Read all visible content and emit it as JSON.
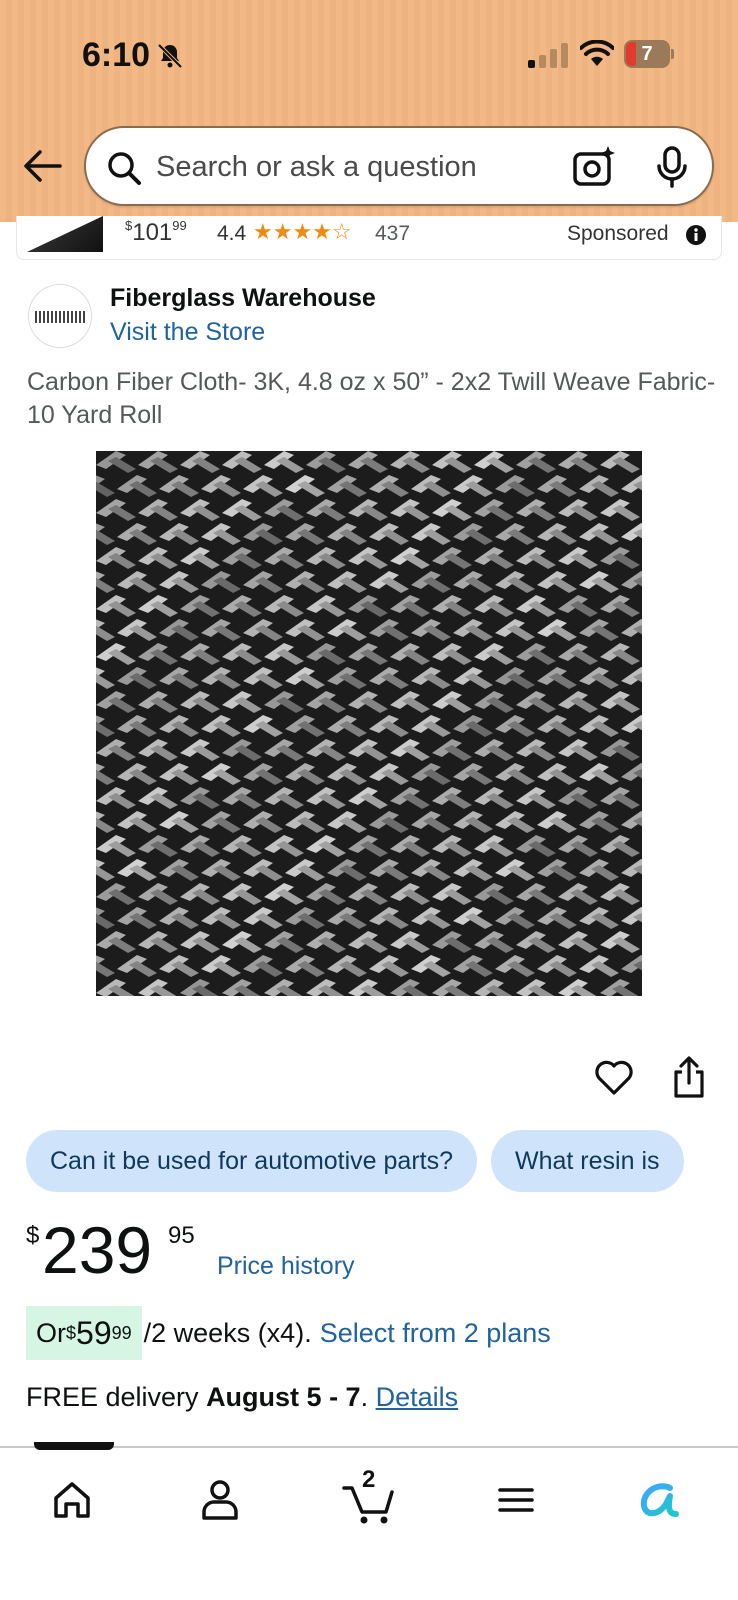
{
  "status_bar": {
    "time": "6:10",
    "battery": "7"
  },
  "search": {
    "placeholder": "Search or ask a question"
  },
  "sponsored_strip": {
    "price_symbol": "$",
    "price_whole": "101",
    "price_fraction": "99",
    "rating": "4.4",
    "stars": "★★★★☆",
    "review_count": "437",
    "label": "Sponsored"
  },
  "brand": {
    "name": "Fiberglass Warehouse",
    "store_link": "Visit the Store"
  },
  "product": {
    "title": "Carbon Fiber Cloth- 3K, 4.8 oz x 50” - 2x2 Twill Weave Fabric- 10 Yard Roll"
  },
  "questions": [
    "Can it be used for automotive parts?",
    "What resin is"
  ],
  "price": {
    "symbol": "$",
    "whole": "239",
    "fraction": "95",
    "history_link": "Price history"
  },
  "installment": {
    "prefix": "Or ",
    "symbol": "$",
    "whole": "59",
    "fraction": "99",
    "terms": " /2 weeks (x4).",
    "link": "Select from 2 plans"
  },
  "delivery": {
    "prefix": "FREE delivery ",
    "dates": "August 5 - 7",
    "separator": ". ",
    "link": "Details"
  },
  "tabbar": {
    "cart_count": "2"
  },
  "colors": {
    "header_bg": "#f2b886",
    "link_blue": "#2162a1",
    "chip_bg": "#cfe4fb",
    "star_orange": "#f08a12",
    "installment_bg": "#d6f5e3"
  },
  "icons": [
    "back-arrow-icon",
    "search-icon",
    "camera-icon",
    "mic-icon",
    "info-icon",
    "heart-icon",
    "share-icon",
    "home-icon",
    "profile-icon",
    "cart-icon",
    "menu-icon",
    "rufus-icon"
  ]
}
